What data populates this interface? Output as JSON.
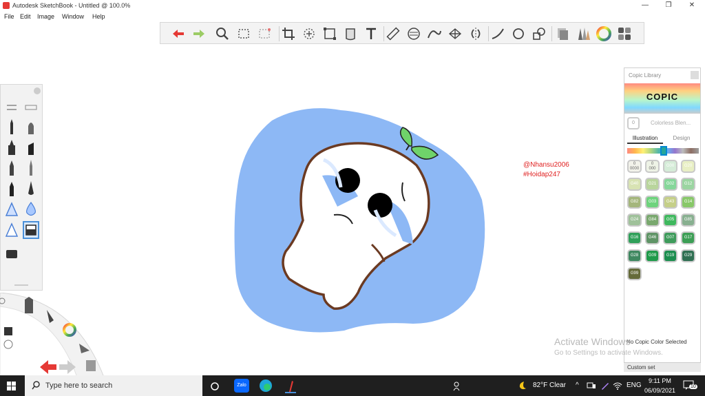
{
  "window": {
    "title": "Autodesk SketchBook - Untitled @ 100.0%",
    "minimize_glyph": "—",
    "maximize_glyph": "❐",
    "close_glyph": "✕"
  },
  "menu": {
    "items": [
      "File",
      "Edit",
      "Image",
      "Window",
      "Help"
    ]
  },
  "toolbar": {
    "icons": [
      "undo-icon",
      "redo-icon",
      "zoom-icon",
      "rect-select-icon",
      "lasso-select-icon",
      "crop-icon",
      "transform-icon",
      "distort-icon",
      "fill-icon",
      "text-icon",
      "ruler-icon",
      "ellipse-guide-icon",
      "french-curve-icon",
      "perspective-icon",
      "symmetry-icon",
      "line-icon",
      "circle-icon",
      "shape-icon",
      "layers-icon",
      "brushes-icon",
      "color-wheel-icon",
      "palette-icon"
    ]
  },
  "canvas": {
    "signature_line1": "@Nhansu2006",
    "signature_line2": "#Hoidap247",
    "watermark_line1": "Activate Windows",
    "watermark_line2": "Go to Settings to activate Windows.",
    "colors": {
      "blob": "#8db8f5",
      "outline": "#6b3a22",
      "leaf": "#6fd36a"
    }
  },
  "copic": {
    "header": "Copic Library",
    "logo_text": "COPIC",
    "colorless_label": "Colorless Blen...",
    "colorless_code": "0",
    "tab_illustration": "Illustration",
    "tab_design": "Design",
    "swatches": [
      {
        "code": "0\n0000",
        "color": "#f2f2ea"
      },
      {
        "code": "0\n000",
        "color": "#eef3e6"
      },
      {
        "code": "G00",
        "color": "#d5ecd8"
      },
      {
        "code": "G20",
        "color": "#e8efc4"
      },
      {
        "code": "G40",
        "color": "#d8e3b3"
      },
      {
        "code": "G21",
        "color": "#b9d59c"
      },
      {
        "code": "G02",
        "color": "#86d79a"
      },
      {
        "code": "G12",
        "color": "#9bd5a1"
      },
      {
        "code": "G82",
        "color": "#a4b67c"
      },
      {
        "code": "G03",
        "color": "#6ed37d"
      },
      {
        "code": "G43",
        "color": "#c5cf88"
      },
      {
        "code": "G14",
        "color": "#88c869"
      },
      {
        "code": "G24",
        "color": "#9fc19a"
      },
      {
        "code": "G84",
        "color": "#79a86e"
      },
      {
        "code": "G05",
        "color": "#3fb85e"
      },
      {
        "code": "G85",
        "color": "#88b090"
      },
      {
        "code": "G16",
        "color": "#2f9f59"
      },
      {
        "code": "G46",
        "color": "#5f9466"
      },
      {
        "code": "G07",
        "color": "#3e9b5b"
      },
      {
        "code": "G17",
        "color": "#3c9e55"
      },
      {
        "code": "G28",
        "color": "#3f8860"
      },
      {
        "code": "G09",
        "color": "#1f9a4a"
      },
      {
        "code": "G19",
        "color": "#1c8e4f"
      },
      {
        "code": "G29",
        "color": "#2f6f52"
      },
      {
        "code": "G99",
        "color": "#656b3a"
      }
    ],
    "status": "No Copic Color Selected",
    "custom_set": "Custom set"
  },
  "taskbar": {
    "search_placeholder": "Type here to search",
    "weather": "82°F  Clear",
    "lang": "ENG",
    "time": "9:11 PM",
    "date": "06/09/2021",
    "notification_count": "10",
    "zalo_label": "Zalo"
  }
}
